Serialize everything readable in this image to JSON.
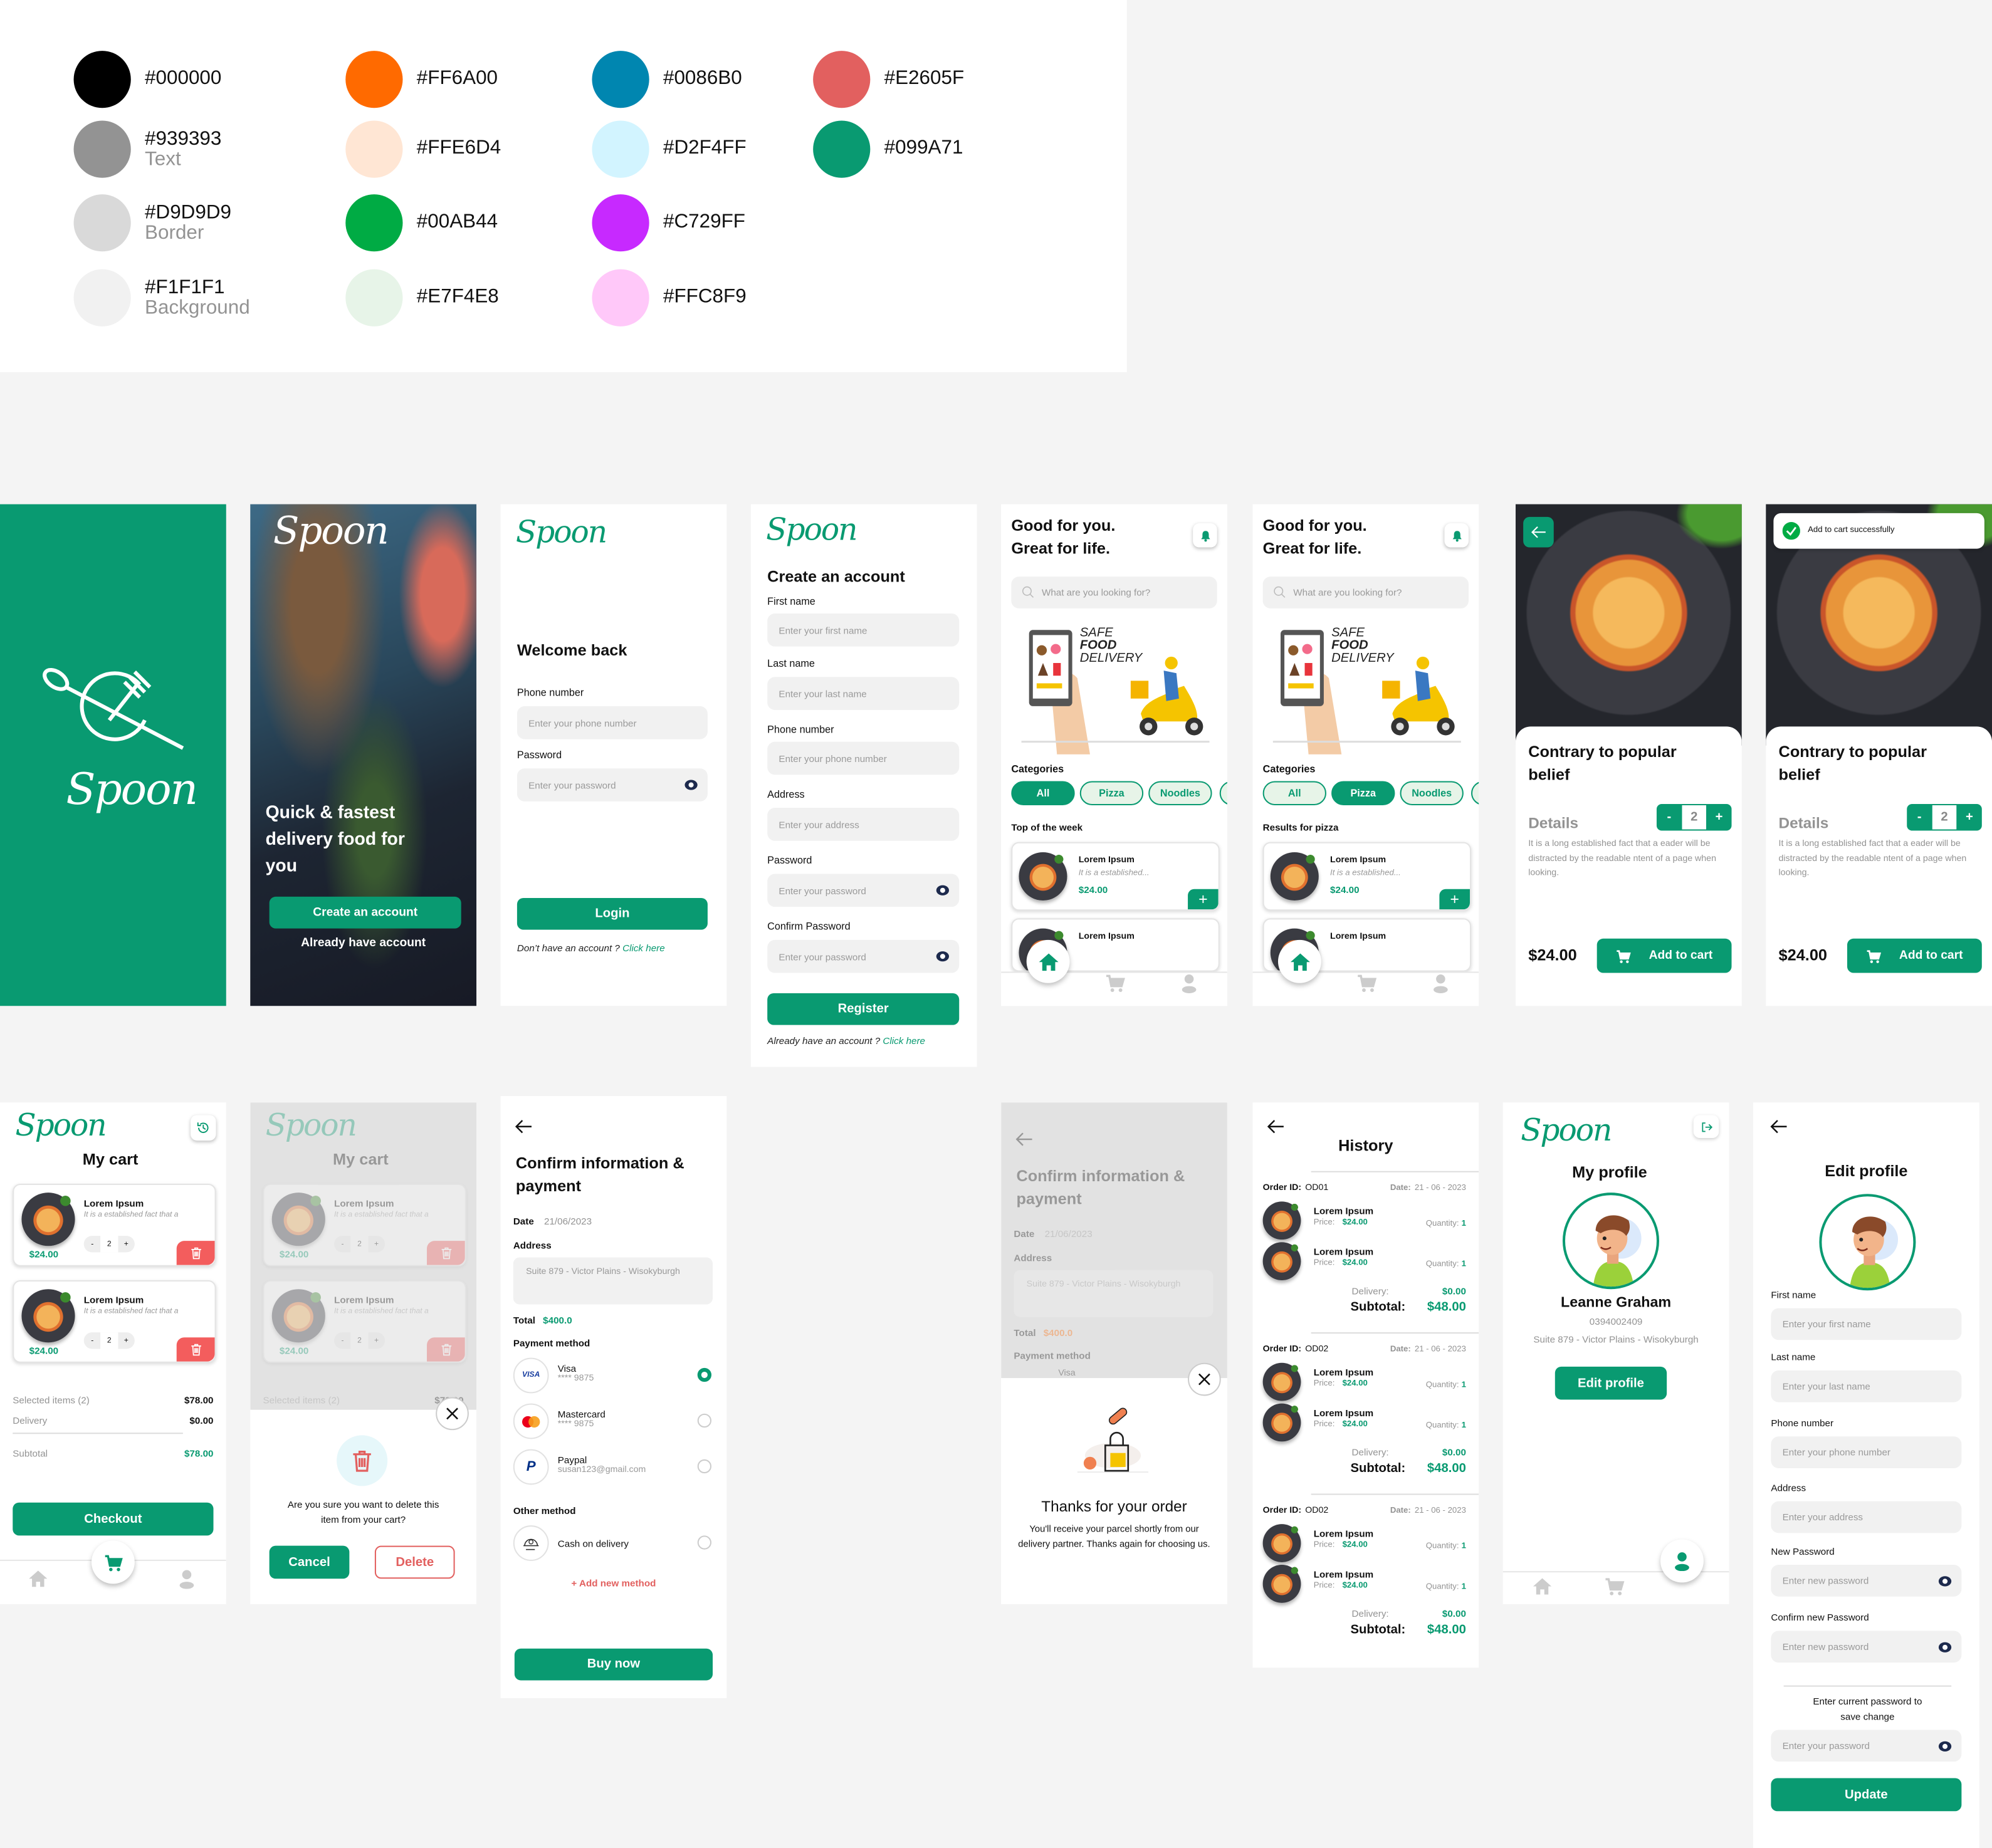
{
  "colors": {
    "primary": "#099A71",
    "danger": "#E2605F",
    "text_gray": "#939393",
    "border": "#D9D9D9",
    "background": "#F1F1F1"
  },
  "palette": [
    {
      "hex": "#000000",
      "label": ""
    },
    {
      "hex": "#939393",
      "label": "Text"
    },
    {
      "hex": "#D9D9D9",
      "label": "Border"
    },
    {
      "hex": "#F1F1F1",
      "label": "Background"
    },
    {
      "hex": "#FF6A00",
      "label": ""
    },
    {
      "hex": "#FFE6D4",
      "label": ""
    },
    {
      "hex": "#00AB44",
      "label": ""
    },
    {
      "hex": "#E7F4E8",
      "label": ""
    },
    {
      "hex": "#0086B0",
      "label": ""
    },
    {
      "hex": "#D2F4FF",
      "label": ""
    },
    {
      "hex": "#C729FF",
      "label": ""
    },
    {
      "hex": "#FFC8F9",
      "label": ""
    },
    {
      "hex": "#E2605F",
      "label": ""
    },
    {
      "hex": "#099A71",
      "label": ""
    }
  ],
  "brand": {
    "logo": "Spoon"
  },
  "onboarding": {
    "headline": "Quick & fastest delivery food for you",
    "create_button": "Create an account",
    "login_link": "Already have account"
  },
  "login": {
    "title": "Welcome back",
    "phone_label": "Phone number",
    "phone_placeholder": "Enter your phone number",
    "password_label": "Password",
    "password_placeholder": "Enter your password",
    "login_button": "Login",
    "footer_text": "Don’t have an account ?",
    "footer_link": "Click here"
  },
  "register": {
    "title": "Create an account",
    "fields": [
      {
        "label": "First name",
        "placeholder": "Enter your first name"
      },
      {
        "label": "Last name",
        "placeholder": "Enter your last name"
      },
      {
        "label": "Phone number",
        "placeholder": "Enter your phone number"
      },
      {
        "label": "Address",
        "placeholder": "Enter your address"
      },
      {
        "label": "Password",
        "placeholder": "Enter your password"
      },
      {
        "label": "Confirm Password",
        "placeholder": "Enter your password"
      }
    ],
    "register_button": "Register",
    "footer_text": "Already have an account ?",
    "footer_link": "Click here"
  },
  "home": {
    "headline_1": "Good for you.",
    "headline_2": "Great for life.",
    "search_placeholder": "What  are you looking for?",
    "banner": {
      "line1": "SAFE",
      "line2": "FOOD",
      "line3": "DELIVERY",
      "order": "ORDER"
    },
    "categories_title": "Categories",
    "categories": [
      "All",
      "Pizza",
      "Noodles"
    ],
    "active_category": "All",
    "section_title": "Top of the week",
    "items": [
      {
        "name": "Lorem Ipsum",
        "desc": "It is a established...",
        "price": "$24.00"
      },
      {
        "name": "Lorem Ipsum"
      }
    ]
  },
  "search_results": {
    "active_category": "Pizza",
    "section_title": "Results for pizza"
  },
  "details": {
    "title": "Contrary to popular belief",
    "details_label": "Details",
    "minus": "-",
    "quantity": "2",
    "plus": "+",
    "description": "It is a long established fact that a eader will be distracted by the readable ntent of a page when looking.",
    "price": "$24.00",
    "add_to_cart": "Add to cart",
    "toast": "Add to cart successfully"
  },
  "cart": {
    "title": "My cart",
    "items": [
      {
        "name": "Lorem Ipsum",
        "desc": "It is a established fact that a",
        "minus": "-",
        "quantity": "2",
        "plus": "+",
        "price": "$24.00"
      },
      {
        "name": "Lorem Ipsum",
        "desc": "It is a established fact that a",
        "minus": "-",
        "quantity": "2",
        "plus": "+",
        "price": "$24.00"
      }
    ],
    "summary": {
      "selected_label": "Selected items (2)",
      "selected_value": "$78.00",
      "delivery_label": "Delivery",
      "delivery_value": "$0.00",
      "subtotal_label": "Subtotal",
      "subtotal_value": "$78.00"
    },
    "checkout": "Checkout"
  },
  "delete_modal": {
    "message": "Are you sure you want to delete this item from your cart?",
    "cancel": "Cancel",
    "delete": "Delete"
  },
  "payment": {
    "title": "Confirm information & payment",
    "date_label": "Date",
    "date": "21/06/2023",
    "address_label": "Address",
    "address": "Suite 879 - Victor Plains - Wisokyburgh",
    "total_label": "Total",
    "total": "$400.0",
    "methods_title": "Payment method",
    "methods": [
      {
        "name": "Visa",
        "detail": "**** 9875",
        "icon": "VISA",
        "selected": true
      },
      {
        "name": "Mastercard",
        "detail": "**** 9875",
        "selected": false
      },
      {
        "name": "Paypal",
        "detail": "susan123@gmail.com",
        "icon": "P",
        "selected": false
      }
    ],
    "other_title": "Other method",
    "other_methods": [
      {
        "name": "Cash on delivery",
        "selected": false
      }
    ],
    "add_method": "+ Add new method",
    "buy_now": "Buy now"
  },
  "thanks": {
    "title": "Thanks for your order",
    "message": "You'll receive your parcel shortly from our delivery partner. Thanks again for choosing us."
  },
  "history": {
    "title": "History",
    "orders": [
      {
        "id_label": "Order ID:",
        "id": "OD01",
        "date_label": "Date:",
        "date": "21 - 06 - 2023",
        "items": [
          {
            "name": "Lorem Ipsum",
            "price_label": "Price:",
            "price": "$24.00",
            "quantity_label": "Quantity:",
            "quantity": "1"
          },
          {
            "name": "Lorem Ipsum",
            "price_label": "Price:",
            "price": "$24.00",
            "quantity_label": "Quantity:",
            "quantity": "1"
          }
        ],
        "delivery_label": "Delivery:",
        "delivery": "$0.00",
        "subtotal_label": "Subtotal:",
        "subtotal": "$48.00"
      },
      {
        "id_label": "Order ID:",
        "id": "OD02",
        "date_label": "Date:",
        "date": "21 - 06 - 2023",
        "items": [
          {
            "name": "Lorem Ipsum",
            "price_label": "Price:",
            "price": "$24.00",
            "quantity_label": "Quantity:",
            "quantity": "1"
          },
          {
            "name": "Lorem Ipsum",
            "price_label": "Price:",
            "price": "$24.00",
            "quantity_label": "Quantity:",
            "quantity": "1"
          }
        ],
        "delivery_label": "Delivery:",
        "delivery": "$0.00",
        "subtotal_label": "Subtotal:",
        "subtotal": "$48.00"
      },
      {
        "id_label": "Order ID:",
        "id": "OD02",
        "date_label": "Date:",
        "date": "21 - 06 - 2023",
        "items": [
          {
            "name": "Lorem Ipsum",
            "price_label": "Price:",
            "price": "$24.00",
            "quantity_label": "Quantity:",
            "quantity": "1"
          },
          {
            "name": "Lorem Ipsum",
            "price_label": "Price:",
            "price": "$24.00",
            "quantity_label": "Quantity:",
            "quantity": "1"
          }
        ],
        "delivery_label": "Delivery:",
        "delivery": "$0.00",
        "subtotal_label": "Subtotal:",
        "subtotal": "$48.00"
      }
    ]
  },
  "profile": {
    "title": "My profile",
    "name": "Leanne Graham",
    "phone": "0394002409",
    "address": "Suite 879 - Victor Plains - Wisokyburgh",
    "edit_button": "Edit profile"
  },
  "edit_profile": {
    "title": "Edit profile",
    "fields": [
      {
        "label": "First name",
        "placeholder": "Enter your first name"
      },
      {
        "label": "Last name",
        "placeholder": "Enter your last name"
      },
      {
        "label": "Phone number",
        "placeholder": "Enter your phone number"
      },
      {
        "label": "Address",
        "placeholder": "Enter your address"
      },
      {
        "label": "New Password",
        "placeholder": "Enter new password"
      },
      {
        "label": "Confirm new Password",
        "placeholder": "Enter new password"
      }
    ],
    "confirm_note": "Enter current password to save change",
    "current_password_placeholder": "Enter your password",
    "update_button": "Update"
  }
}
